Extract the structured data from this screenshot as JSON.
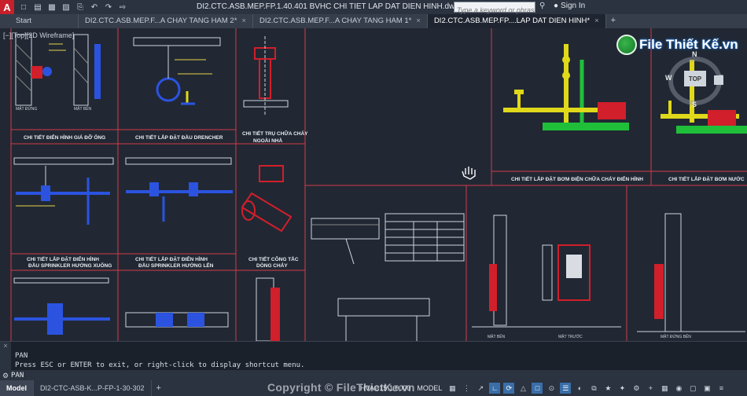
{
  "app": {
    "logo": "A",
    "document_title": "DI2.CTC.ASB.MEP.FP.1.40.401 BVHC CHI TIET LAP DAT DIEN HINH.dwg",
    "search_placeholder": "Type a keyword or phrase",
    "signin_label": "Sign In"
  },
  "tabs": [
    {
      "label": "Start",
      "active": false
    },
    {
      "label": "DI2.CTC.ASB.MEP.F...A CHAY TANG HAM 2*",
      "active": false
    },
    {
      "label": "DI2.CTC.ASB.MEP.F...A CHAY TANG HAM 1*",
      "active": false
    },
    {
      "label": "DI2.CTC.ASB.MEP.FP....LAP DAT DIEN HINH*",
      "active": true
    }
  ],
  "viewport_label": "[−][Top][2D Wireframe]",
  "brand": "File Thiết Kế.vn",
  "viewcube": {
    "top": "TOP",
    "n": "N",
    "s": "S",
    "w": "W",
    "e": "E"
  },
  "drawing": {
    "titles": [
      "CHI TIẾT ĐIỂN HÌNH GIÁ ĐỠ ỐNG",
      "CHI TIẾT LẮP ĐẶT ĐẦU DRENCHER",
      "CHI TIẾT TRỤ CHỮA CHÁY",
      "NGOÀI NHÀ",
      "CHI TIẾT LẮP ĐẶT ĐIỂN HÌNH",
      "ĐẦU SPRINKLER HƯỚNG XUỐNG",
      "ĐẦU SPRINKLER HƯỚNG LÊN",
      "CHI TIẾT CÔNG TẮC",
      "DÒNG CHẢY",
      "CHI TIẾT LẮP ĐẶT BƠM ĐIỆN CHỮA CHÁY ĐIỂN HÌNH",
      "CHI TIẾT LẮP ĐẶT BƠM NƯỚC",
      "MẶT ĐỨNG",
      "MẶT BÊN",
      "MẶT TRƯỚC",
      "MẶT ĐỨNG BÊN"
    ]
  },
  "command": {
    "history": [
      "PAN",
      "Press ESC or ENTER to exit, or right-click to display shortcut menu."
    ],
    "prompt_label": "PAN"
  },
  "statusbar": {
    "layouts": [
      {
        "label": "Model",
        "active": true
      },
      {
        "label": "DI2-CTC-ASB-K...P-FP-1-30-302",
        "active": false
      }
    ],
    "copyright": "Copyright © FileThietKe.vn",
    "scale": "HVAC15:1.0000",
    "mode": "MODEL"
  },
  "colors": {
    "frame": "#d23a4a",
    "pipe_blue": "#2b53e0",
    "valve_yellow": "#e0d81a",
    "pipe_green": "#1fbf3a",
    "motor_red": "#d11f2b",
    "text_white": "#e8ecf2",
    "label_yellow": "#e6d34a"
  }
}
